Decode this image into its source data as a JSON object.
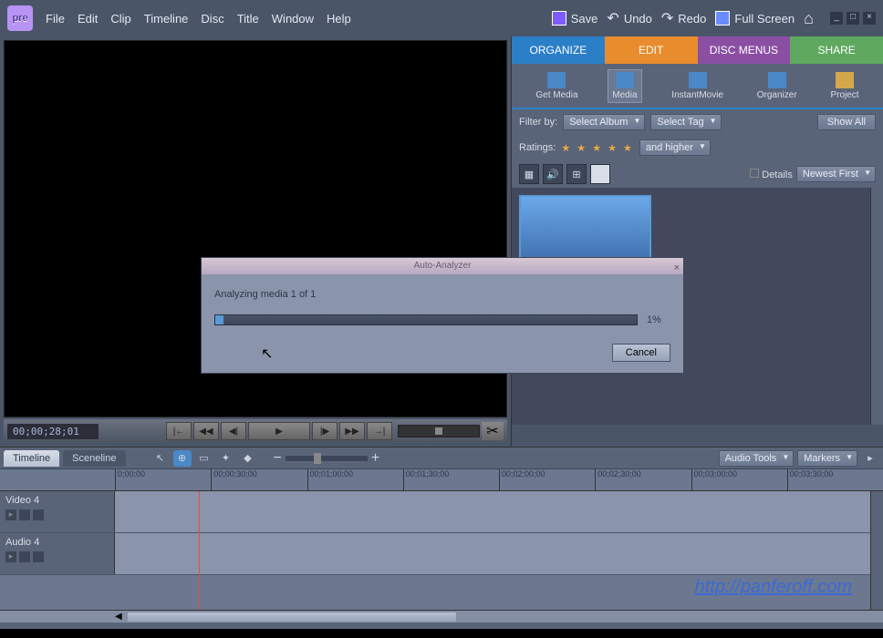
{
  "app": {
    "logo": "pre"
  },
  "menu": {
    "file": "File",
    "edit": "Edit",
    "clip": "Clip",
    "timeline": "Timeline",
    "disc": "Disc",
    "title": "Title",
    "window": "Window",
    "help": "Help"
  },
  "toolbar": {
    "save": "Save",
    "undo": "Undo",
    "redo": "Redo",
    "fullscreen": "Full Screen"
  },
  "transport": {
    "timecode": "00;00;28;01"
  },
  "panel": {
    "tabs": {
      "organize": "ORGANIZE",
      "edit": "EDIT",
      "disc": "DISC MENUS",
      "share": "SHARE"
    },
    "tools": {
      "getmedia": "Get Media",
      "media": "Media",
      "instant": "InstantMovie",
      "organizer": "Organizer",
      "project": "Project"
    },
    "filter": {
      "label": "Filter by:",
      "album": "Select Album",
      "tag": "Select Tag",
      "showall": "Show All"
    },
    "ratings": {
      "label": "Ratings:",
      "andhigher": "and higher"
    },
    "view": {
      "details": "Details",
      "sort": "Newest First"
    }
  },
  "timeline": {
    "tabs": {
      "timeline": "Timeline",
      "sceneline": "Sceneline"
    },
    "header": {
      "audiotools": "Audio Tools",
      "markers": "Markers"
    },
    "ticks": [
      "0;00;00",
      "00;00;30;00",
      "00;01;00;00",
      "00;01;30;00",
      "00;02;00;00",
      "00;02;30;00",
      "00;03;00;00",
      "00;03;30;00"
    ],
    "tracks": {
      "video": "Video 4",
      "audio": "Audio 4"
    }
  },
  "dialog": {
    "title": "Auto-Analyzer",
    "message": "Analyzing media 1 of 1",
    "percent": "1%",
    "progress_width": "2%",
    "cancel": "Cancel"
  },
  "watermark": "http://panferoff.com"
}
